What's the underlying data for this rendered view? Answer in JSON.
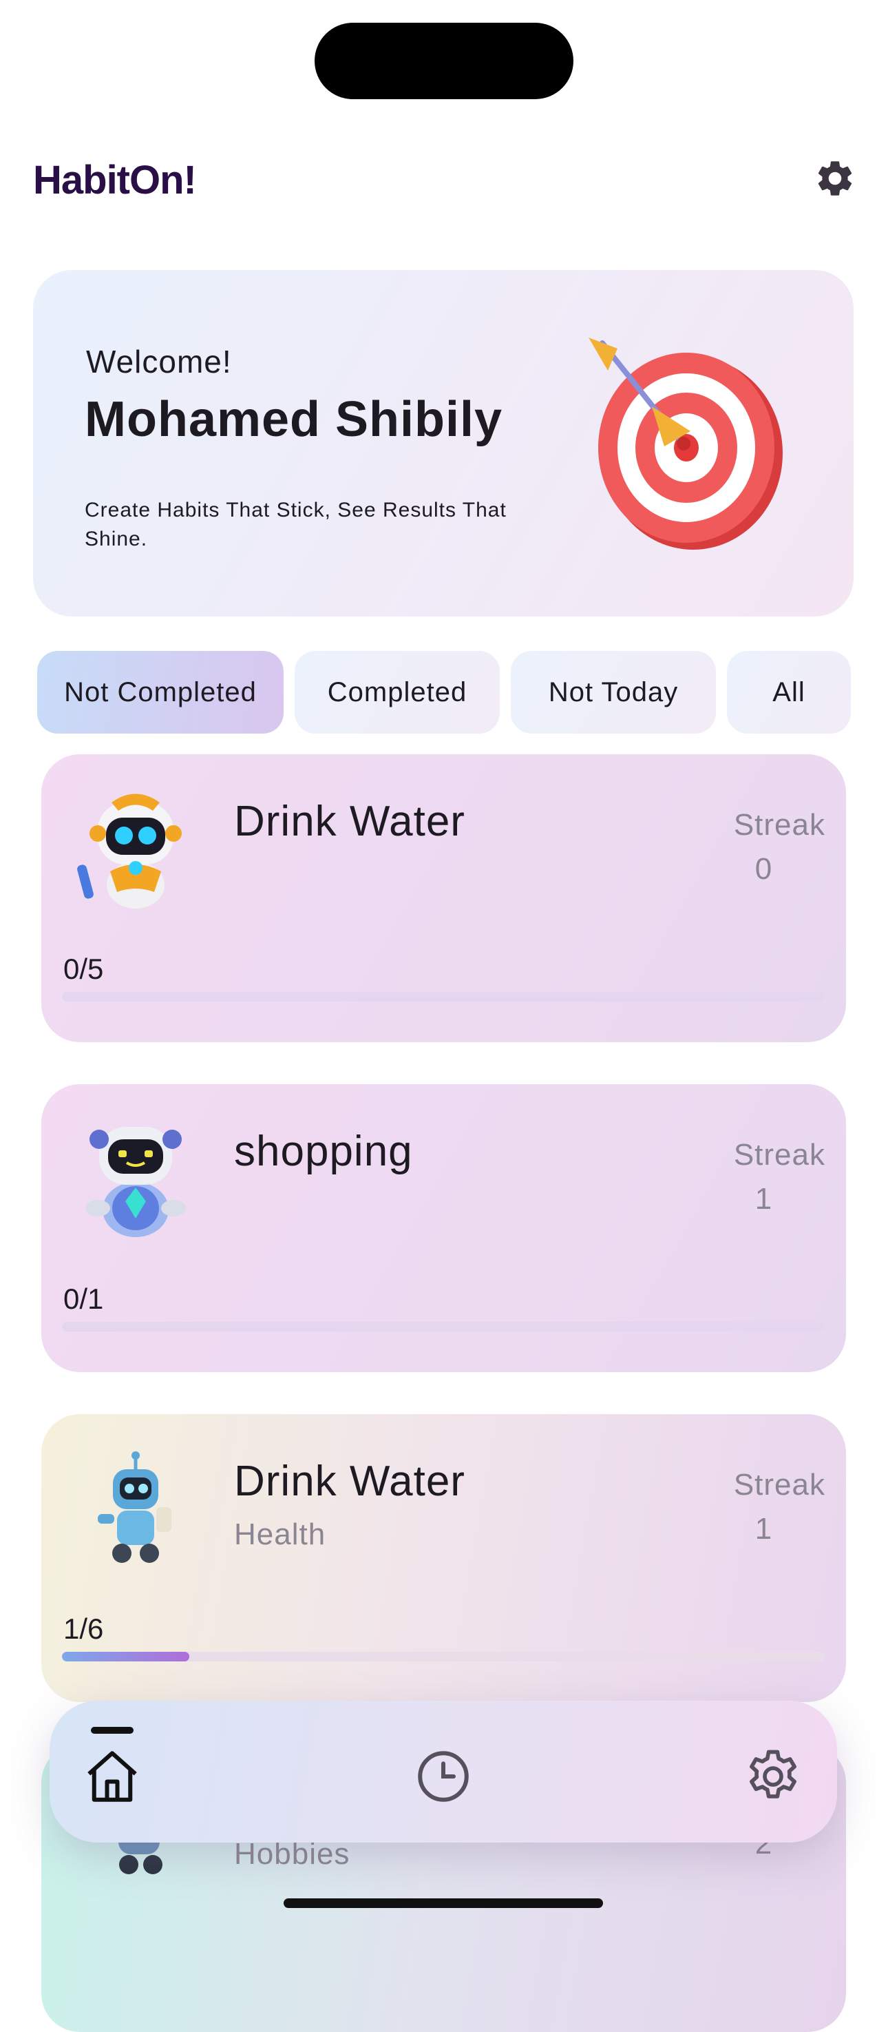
{
  "app": {
    "title": "HabitOn!"
  },
  "welcome": {
    "greeting": "Welcome!",
    "user_name": "Mohamed Shibily",
    "tagline": "Create Habits That Stick, See Results That Shine."
  },
  "filters": [
    {
      "label": "Not Completed",
      "active": true
    },
    {
      "label": "Completed",
      "active": false
    },
    {
      "label": "Not Today",
      "active": false
    },
    {
      "label": "All",
      "active": false
    }
  ],
  "habits": [
    {
      "name": "Drink Water",
      "category": "",
      "streak_label": "Streak",
      "streak": "0",
      "progress_text": "0/5",
      "progress": 0
    },
    {
      "name": "shopping",
      "category": "",
      "streak_label": "Streak",
      "streak": "1",
      "progress_text": "0/1",
      "progress": 0
    },
    {
      "name": "Drink Water",
      "category": "Health",
      "streak_label": "Streak",
      "streak": "1",
      "progress_text": "1/6",
      "progress": 0.1667
    },
    {
      "name": "",
      "category": "Hobbies",
      "streak_label": "",
      "streak": "2",
      "progress_text": "",
      "progress": 0
    }
  ],
  "nav": {
    "items": [
      {
        "icon": "home-icon",
        "active": true
      },
      {
        "icon": "clock-icon",
        "active": false
      },
      {
        "icon": "gear-icon",
        "active": false
      }
    ]
  },
  "colors": {
    "title": "#2a0f46",
    "muted_text": "#8a8592",
    "progress_gradient_start": "#7ea8ea",
    "progress_gradient_end": "#b06ed8"
  }
}
